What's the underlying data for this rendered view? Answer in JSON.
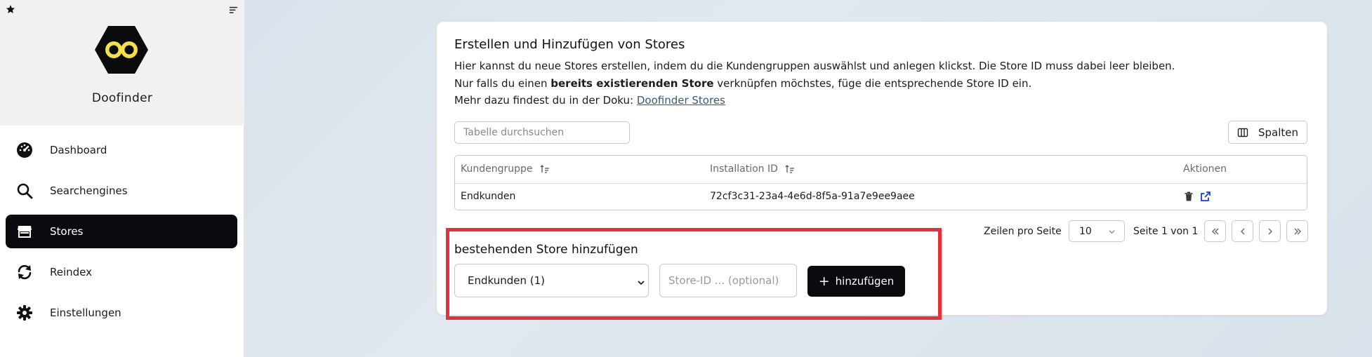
{
  "sidebar": {
    "brand": "Doofinder",
    "items": [
      {
        "label": "Dashboard",
        "icon": "gauge-icon"
      },
      {
        "label": "Searchengines",
        "icon": "search-icon"
      },
      {
        "label": "Stores",
        "icon": "store-icon",
        "active": true
      },
      {
        "label": "Reindex",
        "icon": "refresh-icon"
      },
      {
        "label": "Einstellungen",
        "icon": "gear-icon"
      }
    ]
  },
  "card": {
    "title": "Erstellen und Hinzufügen von Stores",
    "line1": "Hier kannst du neue Stores erstellen, indem du die Kundengruppen auswählst und anlegen klickst. Die Store ID muss dabei leer bleiben.",
    "line2_pre": "Nur falls du einen ",
    "line2_bold": "bereits existierenden Store",
    "line2_post": " verknüpfen möchstes, füge die entsprechende Store ID ein.",
    "line3_pre": "Mehr dazu findest du in der Doku: ",
    "line3_link": "Doofinder Stores"
  },
  "table": {
    "search_placeholder": "Tabelle durchsuchen",
    "columns_button": "Spalten",
    "headers": [
      "Kundengruppe",
      "Installation ID",
      "Aktionen"
    ],
    "rows": [
      {
        "group": "Endkunden",
        "installation_id": "72cf3c31-23a4-4e6d-8f5a-91a7e9ee9aee"
      }
    ]
  },
  "pagination": {
    "rows_label": "Zeilen pro Seite",
    "rows_value": "10",
    "page_label": "Seite 1 von 1"
  },
  "add_store": {
    "title": "bestehenden Store hinzufügen",
    "selected_group": "Endkunden (1)",
    "store_placeholder": "Store-ID ... (optional)",
    "button": "hinzufügen"
  },
  "colors": {
    "accent": "#0a0b0f",
    "highlight": "#e8303c",
    "logo": "#f5e04a"
  }
}
